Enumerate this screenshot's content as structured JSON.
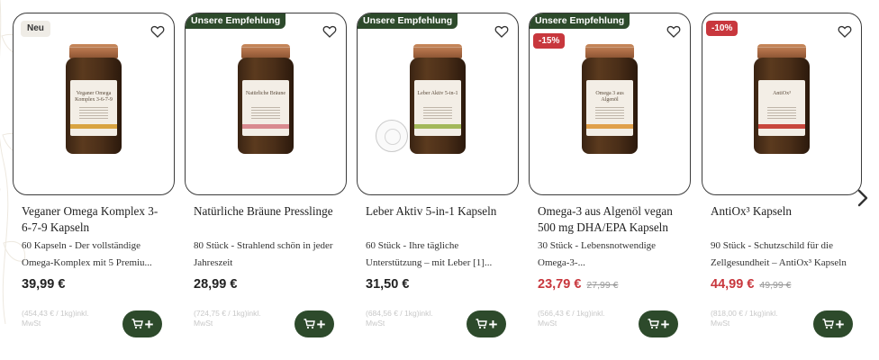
{
  "carousel": {
    "products": [
      {
        "badge_new": "Neu",
        "title": "Veganer Omega Komplex 3-6-7-9 Kapseln",
        "description": "60 Kapseln - Der vollständige Omega-Komplex mit 5 Premiu...",
        "price": "39,99 €",
        "unit_price": "(454,43 € / 1kg)inkl. MwSt",
        "label_text": "Veganer Omega Komplex 3-6-7-9",
        "stripe_color": "#d9a441"
      },
      {
        "badge_recommendation": "Unsere Empfehlung",
        "title": "Natürliche Bräune Presslinge",
        "description": "80 Stück - Strahlend schön in jeder Jahreszeit",
        "price": "28,99 €",
        "unit_price": "(724,75 € / 1kg)inkl. MwSt",
        "label_text": "Natürliche Bräune",
        "stripe_color": "#d98a8f"
      },
      {
        "badge_recommendation": "Unsere Empfehlung",
        "title": "Leber Aktiv 5-in-1 Kapseln",
        "description": "60 Stück - Ihre tägliche Unterstützung – mit Leber [1]...",
        "price": "31,50 €",
        "unit_price": "(684,56 € / 1kg)inkl. MwSt",
        "label_text": "Leber Aktiv 5-in-1",
        "stripe_color": "#a3b85a"
      },
      {
        "badge_recommendation": "Unsere Empfehlung",
        "badge_discount": "-15%",
        "title": "Omega-3 aus Algenöl vegan 500 mg DHA/EPA Kapseln",
        "description": "30 Stück - Lebensnotwendige Omega-3-...",
        "price": "23,79 €",
        "old_price": "27,99 €",
        "unit_price": "(566,43 € / 1kg)inkl. MwSt",
        "label_text": "Omega 3 aus Algenöl",
        "stripe_color": "#e0a04a"
      },
      {
        "badge_discount": "-10%",
        "title": "AntiOx³ Kapseln",
        "description": "90 Stück - Schutzschild für die Zellgesundheit – AntiOx³ Kapseln",
        "price": "44,99 €",
        "old_price": "49,99 €",
        "unit_price": "(818,00 € / 1kg)inkl. MwSt",
        "label_text": "AntiOx³",
        "stripe_color": "#c8473d"
      }
    ]
  },
  "icons": {
    "wishlist": "heart-outline-icon",
    "cart": "cart-icon",
    "add": "plus-icon",
    "next": "chevron-right-icon"
  },
  "colors": {
    "brand_green": "#2d4a2b",
    "sale_red": "#c8373d",
    "jar_lid": "#b57a4f",
    "jar_glass": "#4a2e18"
  }
}
